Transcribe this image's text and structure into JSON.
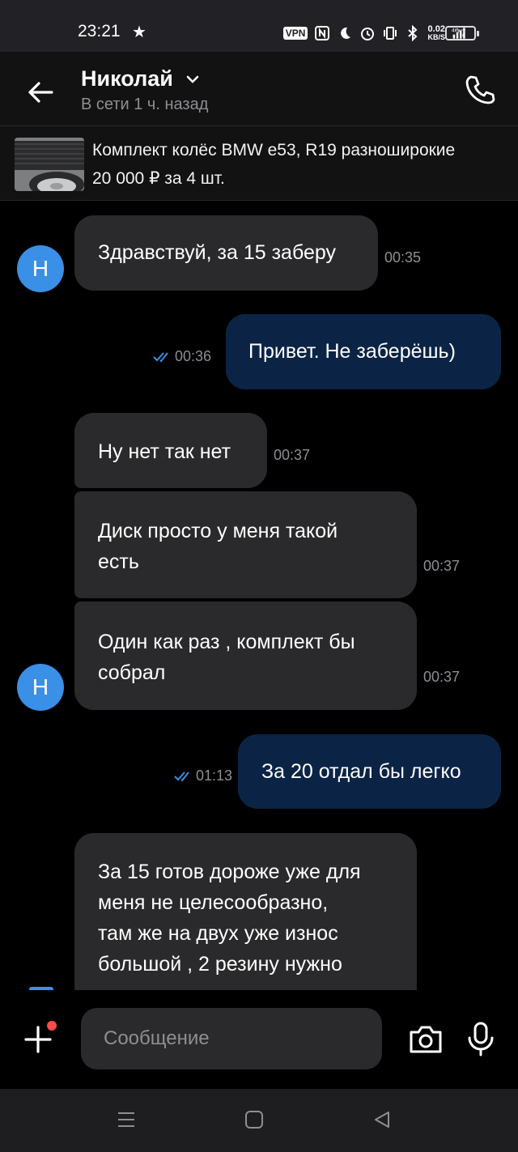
{
  "status_bar": {
    "time": "23:21",
    "vpn": "VPN",
    "net_speed_value": "0.02",
    "net_speed_unit": "KB/S",
    "network": "4G",
    "battery": "77"
  },
  "header": {
    "contact_name": "Николай",
    "contact_status": "В сети 1 ч. назад"
  },
  "ad": {
    "title": "Комплект колёс BMW e53, R19 разноширокие",
    "price": "20 000 ₽ за 4 шт."
  },
  "avatar_letter": "Н",
  "messages": [
    {
      "dir": "in",
      "text": "Здравствуй, за 15 заберу",
      "time": "00:35"
    },
    {
      "dir": "out",
      "text": "Привет. Не заберёшь)",
      "time": "00:36"
    },
    {
      "dir": "in",
      "text": "Ну нет так нет",
      "time": "00:37"
    },
    {
      "dir": "in",
      "text": "Диск просто у меня такой\nесть",
      "time": "00:37"
    },
    {
      "dir": "in",
      "text": "Один как раз , комплект бы\nсобрал",
      "time": "00:37"
    },
    {
      "dir": "out",
      "text": "За 20 отдал бы легко",
      "time": "01:13"
    },
    {
      "dir": "in",
      "text": "За 15 готов дороже уже для\nменя не целесообразно,\nтам же на двух уже износ\nбольшой , 2 резину нужно",
      "time": ""
    }
  ],
  "input": {
    "placeholder": "Сообщение"
  },
  "colors": {
    "incoming_bubble": "#2a2a2c",
    "outgoing_bubble": "#0b2446",
    "avatar": "#3a8fe6",
    "read_check": "#3a8fe6",
    "notification_dot": "#ff4b4b"
  }
}
